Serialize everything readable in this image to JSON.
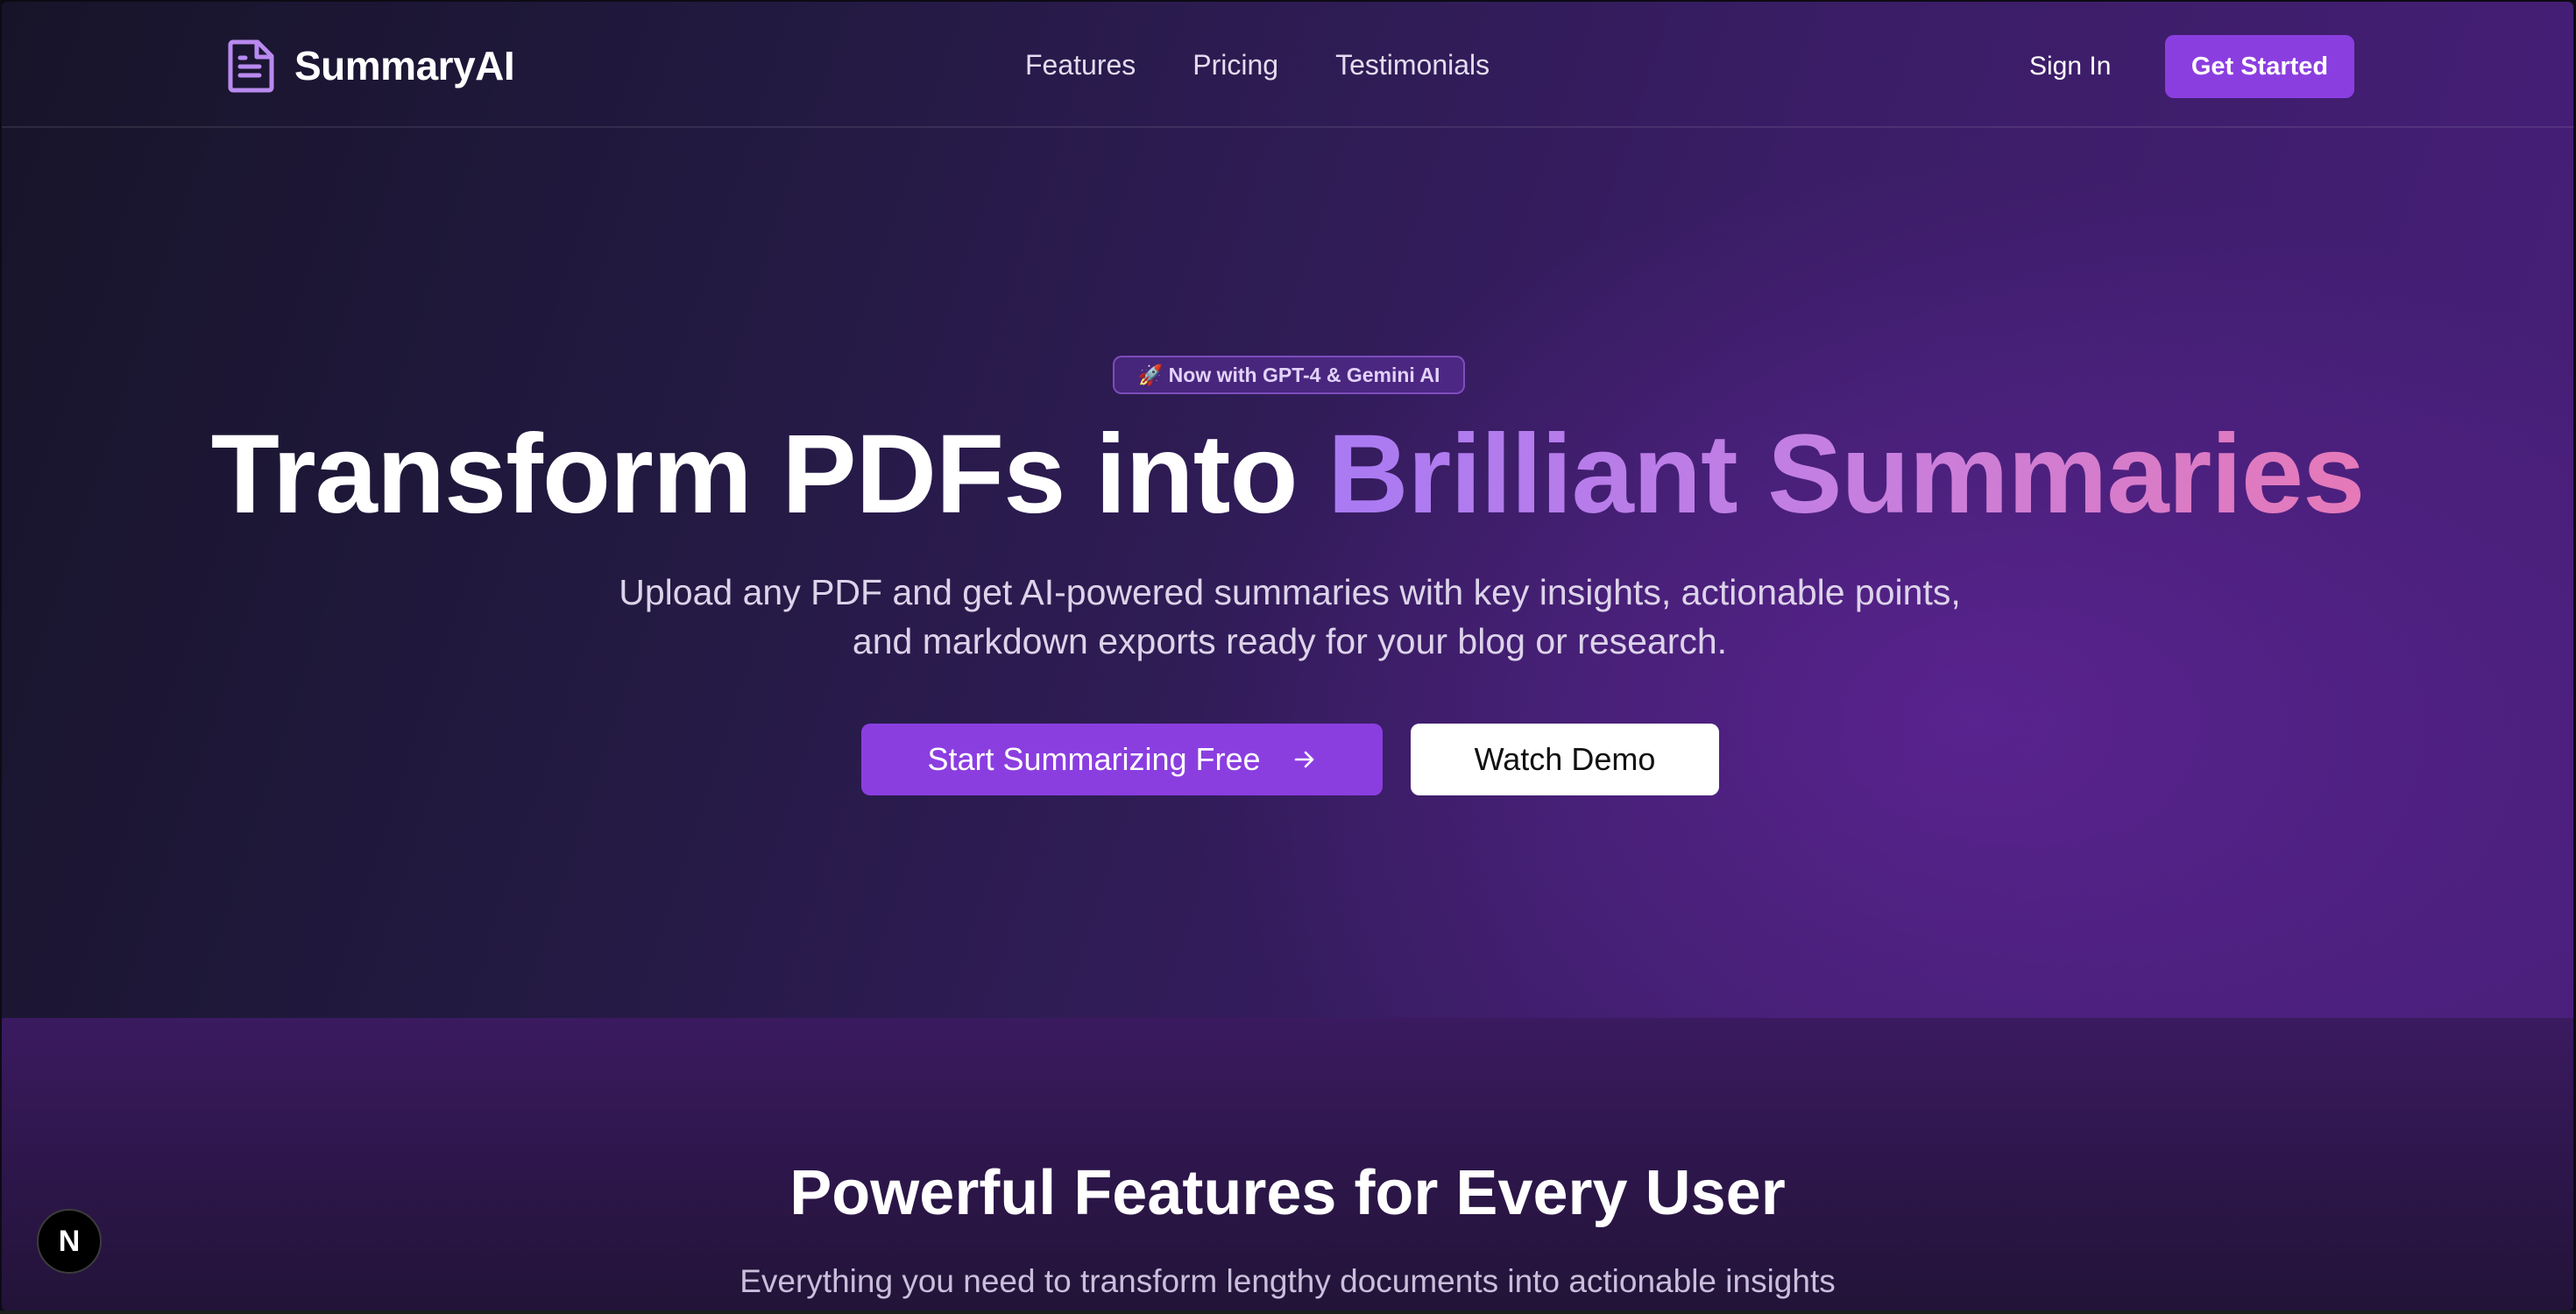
{
  "brand": {
    "name": "SummaryAI",
    "logo_icon": "document-icon",
    "accent_color": "#8b3ee0"
  },
  "nav": {
    "links": [
      "Features",
      "Pricing",
      "Testimonials"
    ],
    "sign_in": "Sign In",
    "get_started": "Get Started"
  },
  "hero": {
    "badge": "🚀 Now with GPT-4 & Gemini AI",
    "title_plain": "Transform PDFs into ",
    "title_accent": "Brilliant Summaries",
    "subtitle": "Upload any PDF and get AI-powered summaries with key insights, actionable points, and markdown exports ready for your blog or research.",
    "primary_cta": "Start Summarizing Free",
    "primary_cta_icon": "arrow-right-icon",
    "secondary_cta": "Watch Demo"
  },
  "features": {
    "title": "Powerful Features for Every User",
    "subtitle": "Everything you need to transform lengthy documents into actionable insights"
  },
  "dev_badge": {
    "label": "N",
    "icon": "nextjs-icon"
  }
}
